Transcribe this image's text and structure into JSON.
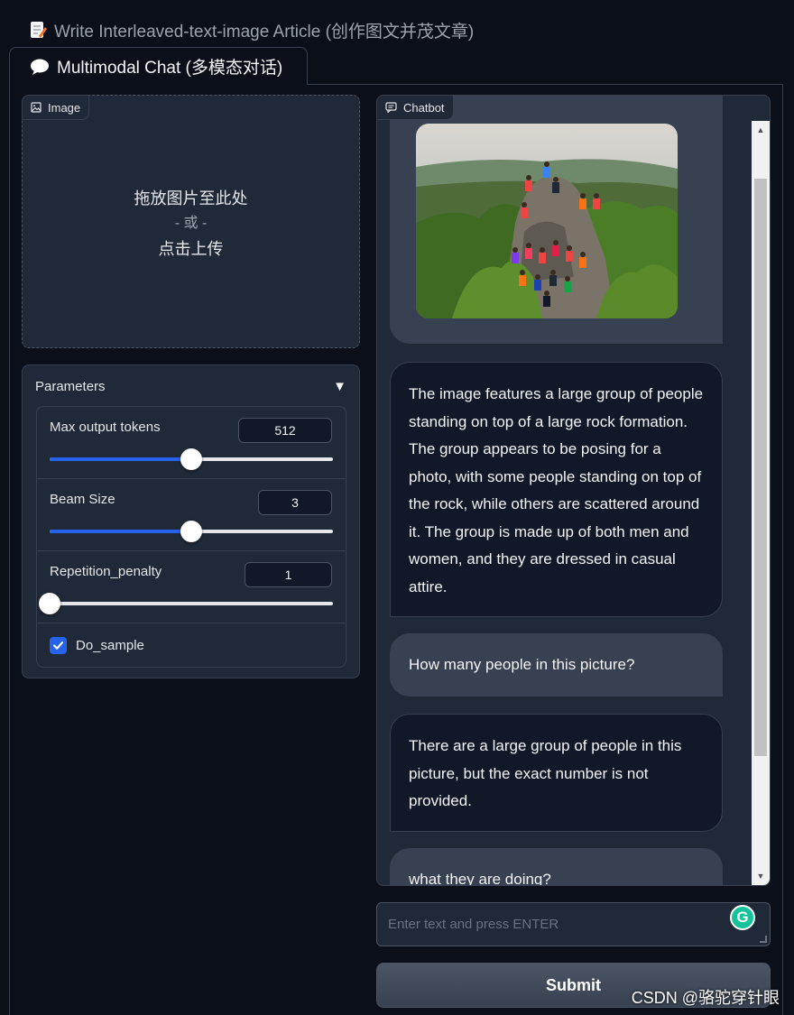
{
  "tabs": [
    {
      "icon": "memo-icon",
      "label": "Write Interleaved-text-image Article (创作图文并茂文章)",
      "active": false
    },
    {
      "icon": "speech-bubble-icon",
      "label": "Multimodal Chat (多模态对话)",
      "active": true
    }
  ],
  "image_input": {
    "label": "Image",
    "drop_text": "拖放图片至此处",
    "or_text": "- 或 -",
    "click_text": "点击上传"
  },
  "parameters": {
    "title": "Parameters",
    "max_output_tokens": {
      "label": "Max output tokens",
      "value": "512",
      "level": 0.5
    },
    "beam_size": {
      "label": "Beam Size",
      "value": "3",
      "level": 0.5
    },
    "repetition_penalty": {
      "label": "Repetition_penalty",
      "value": "1",
      "level": 0.0
    },
    "do_sample": {
      "label": "Do_sample",
      "checked": true
    }
  },
  "chatbot": {
    "label": "Chatbot",
    "messages": [
      {
        "role": "user",
        "type": "image"
      },
      {
        "role": "bot",
        "text": "The image features a large group of people standing on top of a large rock formation. The group appears to be posing for a photo, with some people standing on top of the rock, while others are scattered around it. The group is made up of both men and women, and they are dressed in casual attire."
      },
      {
        "role": "user",
        "text": "How many people in this picture?"
      },
      {
        "role": "bot",
        "text": "There are a large group of people in this picture, but the exact number is not provided."
      },
      {
        "role": "user",
        "text": "what they are doing?"
      }
    ]
  },
  "input": {
    "placeholder": "Enter text and press ENTER"
  },
  "submit_label": "Submit",
  "watermark": "CSDN @骆驼穿针眼",
  "colors": {
    "background": "#0b0f19",
    "panel": "#1f2937",
    "border": "#374151",
    "accent": "#2563eb",
    "user_bubble": "#374151",
    "bot_bubble": "#111827"
  }
}
